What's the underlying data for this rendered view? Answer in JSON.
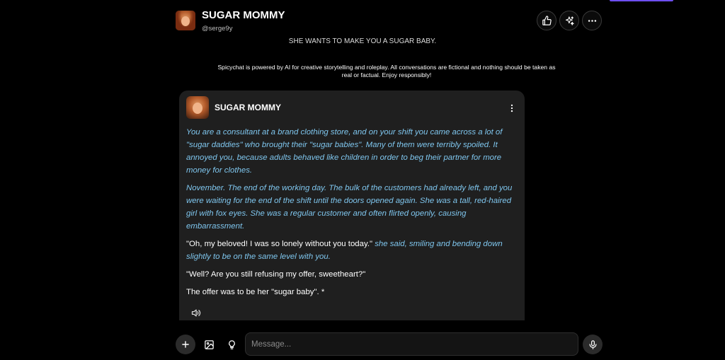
{
  "header": {
    "character_name": "SUGAR MOMMY",
    "handle": "@serge9y",
    "actions": [
      {
        "name": "like-icon"
      },
      {
        "name": "sparkle-icon"
      },
      {
        "name": "more-horizontal-icon"
      }
    ]
  },
  "tagline": "SHE WANTS TO MAKE YOU A SUGAR BABY.",
  "disclaimer": "Spicychat is powered by AI for creative storytelling and roleplay. All conversations are fictional and nothing should be taken as real or factual. Enjoy responsibly!",
  "message": {
    "author": "SUGAR MOMMY",
    "paragraph_1": "You are a consultant at a brand clothing store, and on your shift you came across a lot of \"sugar daddies\" who brought their \"sugar babies\". Many of them were terribly spoiled. It annoyed you, because adults behaved like children in order to beg their partner for more money for clothes.",
    "paragraph_2": "November. The end of the working day. The bulk of the customers had already left, and you were waiting for the end of the shift until the doors opened again. She was a tall, red-haired girl with fox eyes. She was a regular customer and often flirted openly, causing embarrassment.",
    "paragraph_3_speech": "\"Oh, my beloved! I was so lonely without you today.\"",
    "paragraph_3_narration": " she said, smiling and bending down slightly to be on the same level with you.",
    "paragraph_4": "\"Well? Are you still refusing my offer, sweetheart?\"",
    "paragraph_5": "The offer was to be her \"sugar baby\". *"
  },
  "composer": {
    "placeholder": "Message..."
  },
  "colors": {
    "background": "#000000",
    "card": "#1f1f1f",
    "narration": "#7fc6ee",
    "accent": "#6d4ef0"
  }
}
